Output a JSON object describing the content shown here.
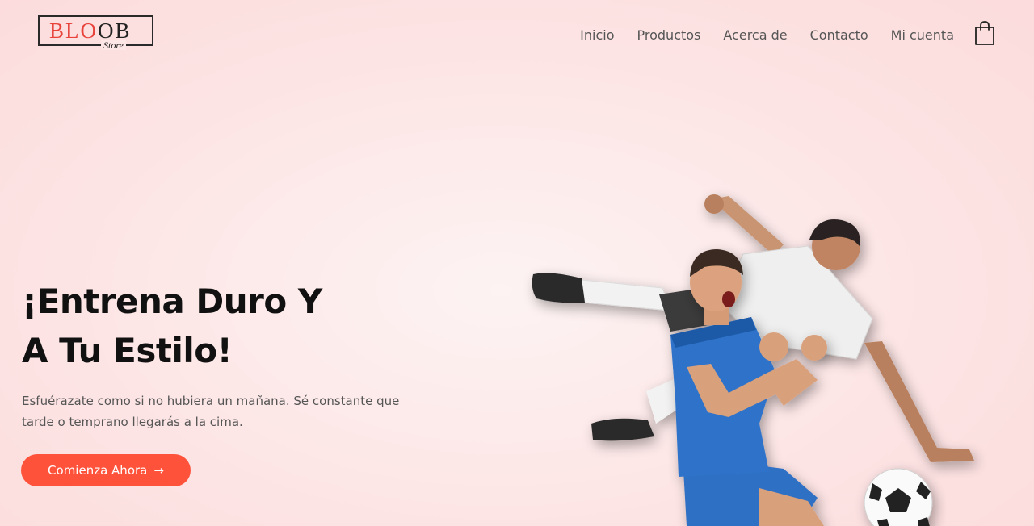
{
  "brand": {
    "logo_letters": [
      {
        "t": "B",
        "color": "#e8423a"
      },
      {
        "t": "L",
        "color": "#e8423a"
      },
      {
        "t": "O",
        "color": "#e8423a"
      },
      {
        "t": "O",
        "color": "#222222"
      },
      {
        "t": "B",
        "color": "#222222"
      }
    ],
    "logo_sub": "Store"
  },
  "nav": {
    "items": [
      {
        "label": "Inicio"
      },
      {
        "label": "Productos"
      },
      {
        "label": "Acerca de"
      },
      {
        "label": "Contacto"
      },
      {
        "label": "Mi cuenta"
      }
    ],
    "cart_icon": "shopping-bag-icon"
  },
  "hero": {
    "title_line1": "¡Entrena Duro Y",
    "title_line2": "A Tu Estilo!",
    "text_line1": "Esfuérazate como si no hubiera un mañana. Sé constante que",
    "text_line2": "tarde o temprano llegarás a la cima.",
    "cta_label": "Comienza Ahora",
    "cta_arrow": "→",
    "image_icon": "soccer-players-illustration"
  },
  "colors": {
    "accent": "#ff523b",
    "logo_red": "#e8423a",
    "background": "#fde5e5",
    "nav_text": "#555555",
    "title_text": "#111111"
  }
}
